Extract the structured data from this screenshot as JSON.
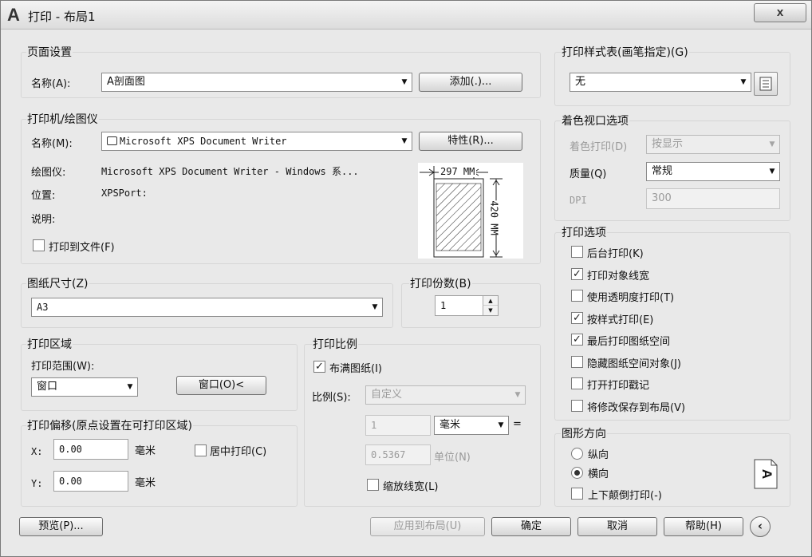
{
  "window": {
    "title": "打印 - 布局1",
    "close_glyph": "x"
  },
  "page_setup": {
    "group_title": "页面设置",
    "name_label": "名称(A):",
    "name_value": "A剖面图",
    "add_button": "添加(.)..."
  },
  "printer": {
    "group_title": "打印机/绘图仪",
    "name_label": "名称(M):",
    "name_value": "Microsoft XPS Document Writer",
    "properties_button": "特性(R)...",
    "plotter_label": "绘图仪:",
    "plotter_value": "Microsoft XPS Document Writer - Windows 系...",
    "location_label": "位置:",
    "location_value": "XPSPort:",
    "description_label": "说明:",
    "print_to_file_label": "打印到文件(F)",
    "print_to_file_checked": false,
    "preview_width_label": "297 MM",
    "preview_height_label": "420 MM"
  },
  "paper_size": {
    "group_title": "图纸尺寸(Z)",
    "value": "A3"
  },
  "copies": {
    "group_title": "打印份数(B)",
    "value": "1"
  },
  "plot_area": {
    "group_title": "打印区域",
    "range_label": "打印范围(W):",
    "range_value": "窗口",
    "window_button": "窗口(O)<"
  },
  "plot_offset": {
    "group_title": "打印偏移(原点设置在可打印区域)",
    "x_label": "X:",
    "x_value": "0.00",
    "x_unit": "毫米",
    "y_label": "Y:",
    "y_value": "0.00",
    "y_unit": "毫米",
    "center_label": "居中打印(C)",
    "center_checked": false
  },
  "plot_scale": {
    "group_title": "打印比例",
    "fit_label": "布满图纸(I)",
    "fit_checked": true,
    "scale_label": "比例(S):",
    "scale_value": "自定义",
    "value1": "1",
    "unit1": "毫米",
    "equals": "=",
    "value2": "0.5367",
    "unit2": "单位(N)",
    "scale_lineweights_label": "缩放线宽(L)",
    "scale_lineweights_checked": false
  },
  "plot_style": {
    "group_title": "打印样式表(画笔指定)(G)",
    "value": "无"
  },
  "shaded_viewport": {
    "group_title": "着色视口选项",
    "shade_label": "着色打印(D)",
    "shade_value": "按显示",
    "quality_label": "质量(Q)",
    "quality_value": "常规",
    "dpi_label": "DPI",
    "dpi_value": "300"
  },
  "plot_options": {
    "group_title": "打印选项",
    "items": [
      {
        "label": "后台打印(K)",
        "checked": false
      },
      {
        "label": "打印对象线宽",
        "checked": true
      },
      {
        "label": "使用透明度打印(T)",
        "checked": false
      },
      {
        "label": "按样式打印(E)",
        "checked": true
      },
      {
        "label": "最后打印图纸空间",
        "checked": true
      },
      {
        "label": "隐藏图纸空间对象(J)",
        "checked": false
      },
      {
        "label": "打开打印戳记",
        "checked": false
      },
      {
        "label": "将修改保存到布局(V)",
        "checked": false
      }
    ]
  },
  "orientation": {
    "group_title": "图形方向",
    "portrait_label": "纵向",
    "landscape_label": "横向",
    "upside_down_label": "上下颠倒打印(-)",
    "selected": "landscape",
    "icon_letter": "A"
  },
  "footer": {
    "preview_button": "预览(P)...",
    "apply_button": "应用到布局(U)",
    "ok_button": "确定",
    "cancel_button": "取消",
    "help_button": "帮助(H)",
    "collapse_glyph": "‹"
  },
  "glyphs": {
    "dropdown_arrow": "▼",
    "check_mark": "✓",
    "spin_up": "▲",
    "spin_down": "▼"
  }
}
